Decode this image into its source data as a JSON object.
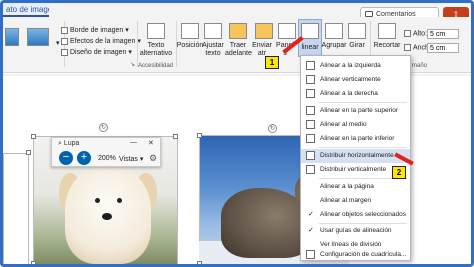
{
  "window": {
    "tab_title": "ato de imagen",
    "comments_label": "Comentarios"
  },
  "ribbon": {
    "picture_styles": {
      "border_label": "Borde de imagen",
      "effects_label": "Efectos de la imagen",
      "layout_label": "Diseño de imagen"
    },
    "accessibility": {
      "alt_text_line1": "Texto",
      "alt_text_line2": "alternativo",
      "group_label": "Accesibilidad"
    },
    "arrange": {
      "position": "Posición",
      "wrap_line1": "Ajustar",
      "wrap_line2": "texto",
      "forward_line1": "Traer",
      "forward_line2": "adelante",
      "backward_line1": "Enviar",
      "backward_line2": "atr",
      "pane_line1": "Panel",
      "pane_line2": "s",
      "align": "linear",
      "group": "Agrupar",
      "rotate": "Girar",
      "group_label": "ganizar"
    },
    "size": {
      "crop": "Recortar",
      "height_label": "Alto:",
      "height_value": "5 cm",
      "width_label": "Ancho:",
      "width_value": "5 cm",
      "group_label": "maño"
    }
  },
  "magnifier": {
    "title": "Lupa",
    "zoom": "200%",
    "views": "Vistas"
  },
  "align_menu": {
    "items": [
      {
        "label": "Alinear a la izquierda"
      },
      {
        "label": "Alinear verticalmente"
      },
      {
        "label": "Alinear a la derecha"
      },
      {
        "label": "Alinear en la parte superior"
      },
      {
        "label": "Alinear al medio"
      },
      {
        "label": "Alinear en la parte inferior"
      },
      {
        "label": "Distribuir horizontalmente"
      },
      {
        "label": "Distribuir verticalmente"
      },
      {
        "label": "Alinear a la página"
      },
      {
        "label": "Alinear al margen"
      },
      {
        "label": "Alinear objetos seleccionados"
      },
      {
        "label": "Usar guías de alineación"
      },
      {
        "label": "Ver líneas de división"
      },
      {
        "label": "Configuración de cuadrícula..."
      }
    ]
  },
  "callouts": {
    "one": "1",
    "two": "2"
  },
  "colors": {
    "accent": "#2b579a",
    "highlight": "#d5e1f2",
    "callout": "#ffe600",
    "arrow": "#e2231a"
  }
}
